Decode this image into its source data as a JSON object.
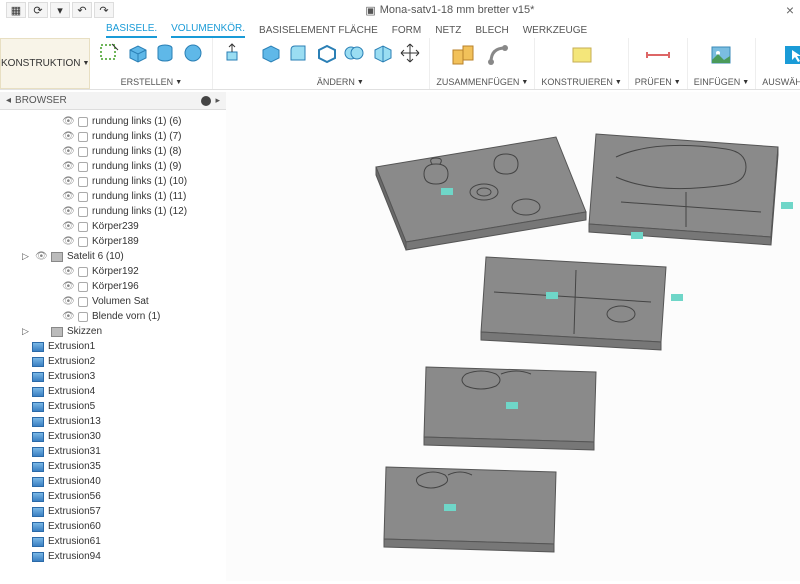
{
  "titlebar": {
    "doc_title": "Mona-satv1-18 mm bretter v15*",
    "close": "×"
  },
  "ribbon": {
    "konstruktion": "KONSTRUKTION",
    "tabs": {
      "basisele": "BASISELE.",
      "volumenkor": "VOLUMENKÖR.",
      "basiselementflache": "BASISELEMENT FLÄCHE",
      "form": "FORM",
      "netz": "NETZ",
      "blech": "BLECH",
      "werkzeuge": "WERKZEUGE"
    },
    "groups": {
      "erstellen": "ERSTELLEN",
      "andern": "ÄNDERN",
      "zusammenfugen": "ZUSAMMENFÜGEN",
      "konstruieren": "KONSTRUIEREN",
      "prufen": "PRÜFEN",
      "einfugen": "EINFÜGEN",
      "auswahlen": "AUSWÄHLEN"
    }
  },
  "browser": {
    "title": "BROWSER",
    "items": [
      "rundung links (1) (6)",
      "rundung links (1) (7)",
      "rundung links (1) (8)",
      "rundung links (1) (9)",
      "rundung links (1) (10)",
      "rundung links (1) (11)",
      "rundung links (1) (12)",
      "Körper239",
      "Körper189"
    ],
    "group": "Satelit 6 (10)",
    "group_items": [
      "Körper192",
      "Körper196",
      "Volumen Sat",
      "Blende vorn (1)"
    ],
    "skizzen": "Skizzen",
    "sketches": [
      "Extrusion1",
      "Extrusion2",
      "Extrusion3",
      "Extrusion4",
      "Extrusion5",
      "Extrusion13",
      "Extrusion30",
      "Extrusion31",
      "Extrusion35",
      "Extrusion40",
      "Extrusion56",
      "Extrusion57",
      "Extrusion60",
      "Extrusion61",
      "Extrusion94"
    ]
  }
}
